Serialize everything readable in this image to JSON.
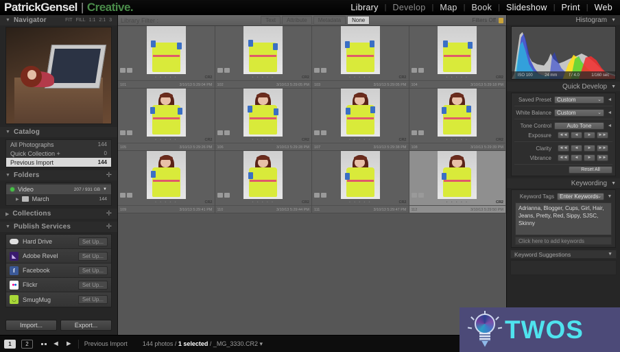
{
  "app": {
    "brand_name": "PatrickGensel",
    "brand_separator": "|",
    "brand_tagline": "Creative.",
    "modules": [
      "Library",
      "Develop",
      "Map",
      "Book",
      "Slideshow",
      "Print",
      "Web"
    ],
    "active_module": "Library"
  },
  "left_panel": {
    "navigator": {
      "title": "Navigator",
      "zoom_options": [
        "FIT",
        "FILL",
        "1:1",
        "2:1",
        "3"
      ]
    },
    "catalog": {
      "title": "Catalog",
      "items": [
        {
          "label": "All Photographs",
          "count": "144",
          "selected": false
        },
        {
          "label": "Quick Collection  +",
          "count": "0",
          "selected": false
        },
        {
          "label": "Previous Import",
          "count": "144",
          "selected": true
        }
      ]
    },
    "folders": {
      "title": "Folders",
      "volume": {
        "label": "Video",
        "capacity": "207 / 931 GB"
      },
      "items": [
        {
          "label": "March",
          "count": "144"
        }
      ]
    },
    "collections": {
      "title": "Collections"
    },
    "publish_services": {
      "title": "Publish Services",
      "setup_label": "Set Up...",
      "items": [
        {
          "label": "Hard Drive",
          "icon": "harddrive-icon",
          "color": "#e8e8e8",
          "glyph": ""
        },
        {
          "label": "Adobe Revel",
          "icon": "adobe-revel-icon",
          "color": "#3a1a6e",
          "glyph": "◣"
        },
        {
          "label": "Facebook",
          "icon": "facebook-icon",
          "color": "#3b5998",
          "glyph": "f"
        },
        {
          "label": "Flickr",
          "icon": "flickr-icon",
          "color": "#ffffff",
          "glyph": "••"
        },
        {
          "label": "SmugMug",
          "icon": "smugmug-icon",
          "color": "#a8d838",
          "glyph": "◡"
        }
      ]
    },
    "buttons": {
      "import": "Import...",
      "export": "Export..."
    }
  },
  "filter_bar": {
    "label": "Library Filter :",
    "tabs": [
      "Text",
      "Attribute",
      "Metadata",
      "None"
    ],
    "active_tab": "None",
    "filters_state": "Filters Off",
    "lock_icon": "lock-icon"
  },
  "grid": {
    "columns": 4,
    "cells": [
      {
        "index": "101",
        "format": "CR2",
        "timestamp": "3/10/13 5:29:04 PM",
        "selected": false,
        "partial_top": true
      },
      {
        "index": "102",
        "format": "CR2",
        "timestamp": "3/10/13 5:29:05 PM",
        "selected": false,
        "partial_top": true
      },
      {
        "index": "103",
        "format": "CR2",
        "timestamp": "3/10/13 5:29:05 PM",
        "selected": false,
        "partial_top": true
      },
      {
        "index": "104",
        "format": "CR2",
        "timestamp": "3/10/13 5:29:18 PM",
        "selected": false,
        "partial_top": true
      },
      {
        "index": "105",
        "format": "CR2",
        "timestamp": "3/10/13 5:29:26 PM",
        "selected": false,
        "partial_top": false
      },
      {
        "index": "106",
        "format": "CR2",
        "timestamp": "3/10/13 5:29:28 PM",
        "selected": false,
        "partial_top": false
      },
      {
        "index": "107",
        "format": "CR2",
        "timestamp": "3/10/13 5:29:38 PM",
        "selected": false,
        "partial_top": false
      },
      {
        "index": "108",
        "format": "CR2",
        "timestamp": "3/10/13 5:29:39 PM",
        "selected": false,
        "partial_top": false
      },
      {
        "index": "109",
        "format": "CR2",
        "timestamp": "3/10/13 5:29:41 PM",
        "selected": false,
        "partial_top": false
      },
      {
        "index": "110",
        "format": "CR2",
        "timestamp": "3/10/13 5:29:44 PM",
        "selected": false,
        "partial_top": false
      },
      {
        "index": "111",
        "format": "CR2",
        "timestamp": "3/10/13 5:29:47 PM",
        "selected": false,
        "partial_top": false
      },
      {
        "index": "112",
        "format": "CR2",
        "timestamp": "3/10/13 5:29:50 PM",
        "selected": true,
        "partial_top": false
      }
    ]
  },
  "right_panel": {
    "histogram": {
      "title": "Histogram",
      "exif": {
        "iso": "ISO 100",
        "focal_length": "24 mm",
        "aperture": "f / 4.0",
        "shutter": "1/160 sec"
      }
    },
    "quick_develop": {
      "title": "Quick Develop",
      "saved_preset": {
        "label": "Saved Preset",
        "value": "Custom"
      },
      "white_balance": {
        "label": "White Balance",
        "value": "Custom"
      },
      "tone_control": {
        "label": "Tone Control",
        "button": "Auto Tone"
      },
      "exposure": {
        "label": "Exposure",
        "steps": [
          "◄◄",
          "◄",
          "►",
          "►►"
        ]
      },
      "clarity": {
        "label": "Clarity",
        "steps": [
          "◄◄",
          "◄",
          "►",
          "►►"
        ]
      },
      "vibrance": {
        "label": "Vibrance",
        "steps": [
          "◄◄",
          "◄",
          "►",
          "►►"
        ]
      },
      "reset": "Reset All"
    },
    "keywording": {
      "title": "Keywording",
      "tags_label": "Keyword Tags",
      "tags_mode": "Enter Keywords",
      "keywords": "Adrianna, Blogger, Cups, Girl, Hair, Jeans, Pretty, Red, Sippy, SJSC, Skinny",
      "add_placeholder": "Click here to add keywords",
      "suggestions_title": "Keyword Suggestions"
    }
  },
  "bottom_bar": {
    "view_1": "1",
    "view_2": "2",
    "grid_icon": "grid-view-icon",
    "prev_icon": "previous-photo-arrow",
    "next_icon": "next-photo-arrow",
    "source": "Previous Import",
    "status_count": "144 photos /",
    "status_selected": "1 selected",
    "status_file": "/ _MG_3330.CR2",
    "status_caret": "▾"
  },
  "watermark": {
    "text": "TWOS",
    "icon": "lightbulb-icon",
    "bg": "#4c4a78",
    "fg": "#4fe3ee"
  }
}
